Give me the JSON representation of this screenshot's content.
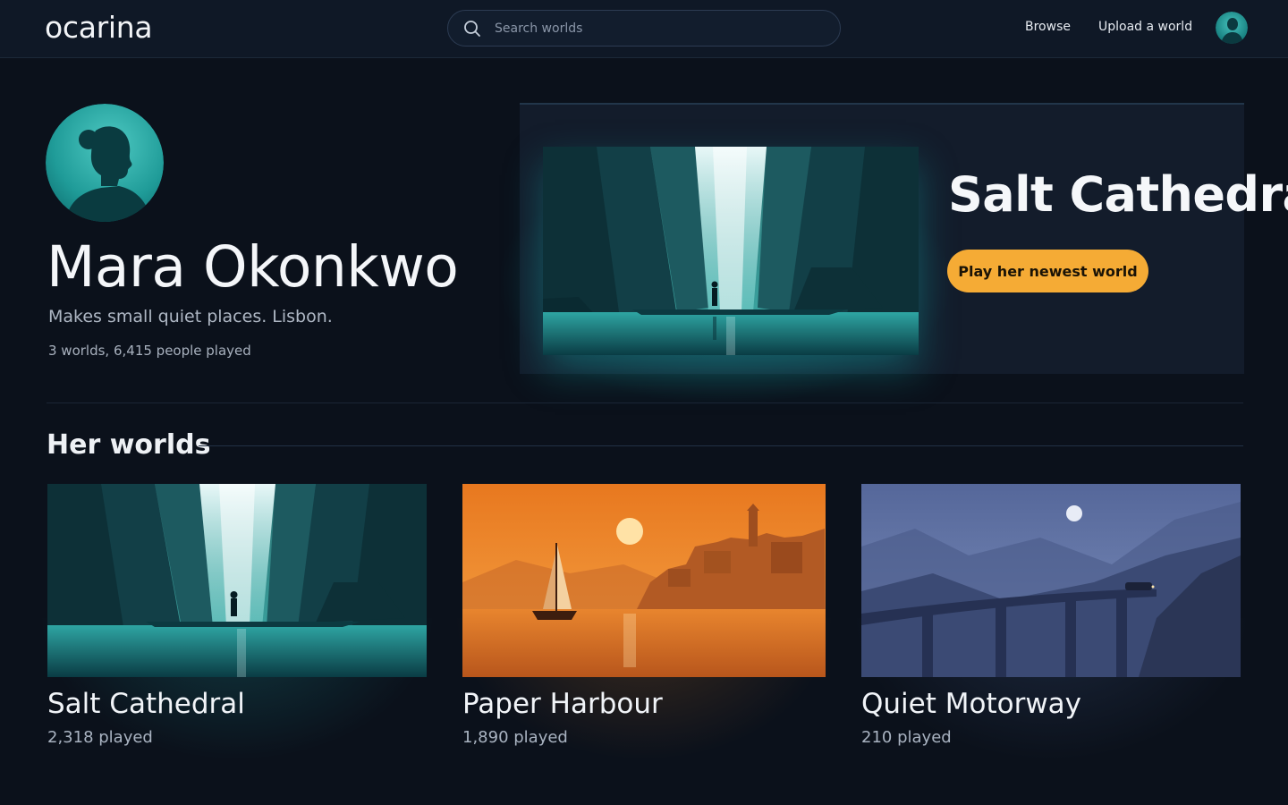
{
  "app": {
    "logo": "ocarina"
  },
  "search": {
    "placeholder": "Search worlds",
    "value": ""
  },
  "nav": {
    "browse": "Browse",
    "upload": "Upload a world"
  },
  "profile": {
    "name": "Mara Okonkwo",
    "bio": "Makes small quiet places. Lisbon.",
    "stats": "3 worlds, 6,415 people played"
  },
  "featured": {
    "title": "Salt Cathedral",
    "cta": "Play her newest world"
  },
  "section": {
    "title": "Her worlds"
  },
  "worlds": [
    {
      "title": "Salt Cathedral",
      "played": "2,318 played",
      "accent": "#1fb3b3"
    },
    {
      "title": "Paper Harbour",
      "played": "1,890 played",
      "accent": "#f08a2a"
    },
    {
      "title": "Quiet Motorway",
      "played": "210 played",
      "accent": "#4f6aa0"
    }
  ],
  "colors": {
    "background": "#0b111b",
    "cta": "#f5ab35",
    "teal": "#1fb3b3"
  },
  "icons": {
    "search": "search-icon",
    "avatar": "avatar"
  }
}
